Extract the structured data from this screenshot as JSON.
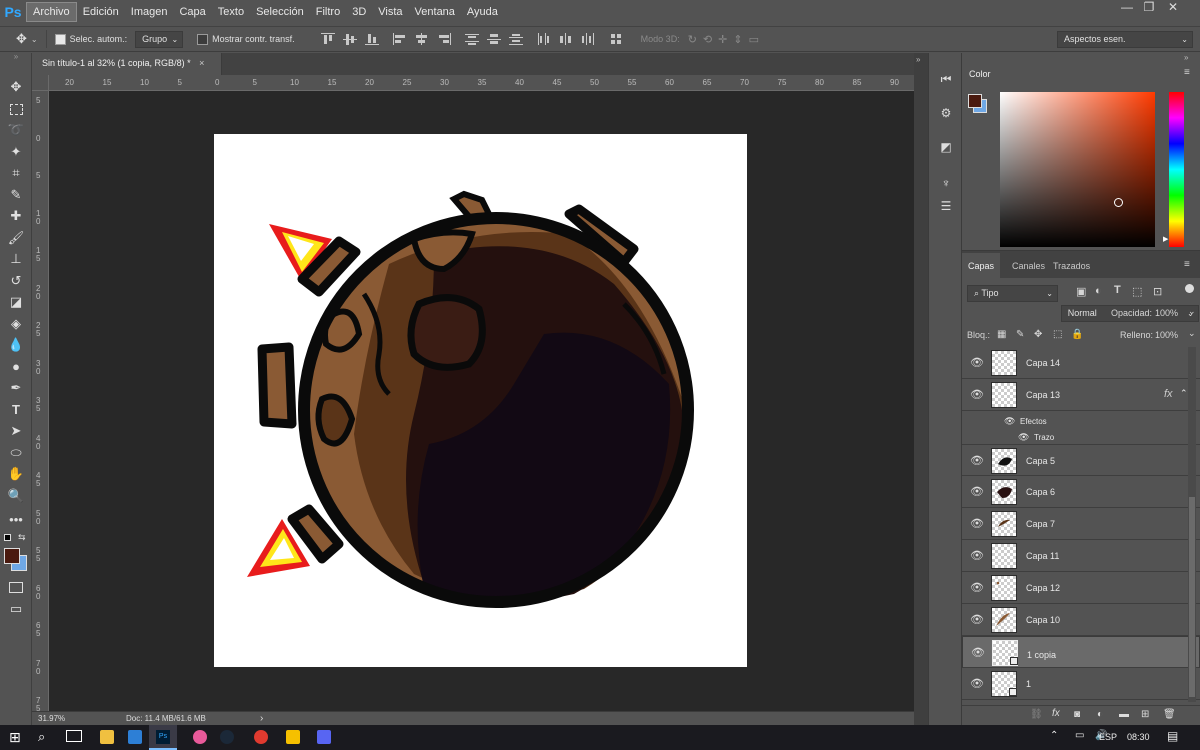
{
  "app": {
    "logo": "Ps"
  },
  "menu": [
    "Archivo",
    "Edición",
    "Imagen",
    "Capa",
    "Texto",
    "Selección",
    "Filtro",
    "3D",
    "Vista",
    "Ventana",
    "Ayuda"
  ],
  "window_controls": [
    "—",
    "❐",
    "✕"
  ],
  "options": {
    "auto_select_label": "Selec. autom.:",
    "auto_select_value": "Grupo",
    "transform_label": "Mostrar contr. transf.",
    "mode3d_label": "Modo 3D:",
    "workspace": "Aspectos esen."
  },
  "document": {
    "tab_title": "Sin título-1 al 32% (1 copia, RGB/8) *",
    "tab_close": "×"
  },
  "ruler": {
    "top": [
      "20",
      "15",
      "10",
      "5",
      "0",
      "5",
      "10",
      "15",
      "20",
      "25",
      "30",
      "35",
      "40",
      "45",
      "50",
      "55",
      "60",
      "65",
      "70",
      "75",
      "80",
      "85",
      "90"
    ],
    "left": [
      "5",
      "0",
      "5",
      "1 0",
      "1 5",
      "2 0",
      "2 5",
      "3 0",
      "3 5",
      "4 0",
      "4 5",
      "5 0",
      "5 5",
      "6 0",
      "6 5",
      "7 0",
      "7 5"
    ]
  },
  "status": {
    "zoom": "31.97%",
    "doc": "Doc: 11.4 MB/61.6 MB",
    "arrow": "›"
  },
  "color_panel": {
    "title": "Color",
    "fg": "#4a1a0f",
    "bg": "#6fa8e6"
  },
  "layers_panel": {
    "tabs": [
      "Capas",
      "Canales",
      "Trazados"
    ],
    "filter": "Tipo",
    "blend_mode": "Normal",
    "opacity_label": "Opacidad:",
    "opacity": "100%",
    "lock_label": "Bloq.:",
    "fill_label": "Relleno:",
    "fill": "100%",
    "layers": [
      {
        "name": "Capa 14"
      },
      {
        "name": "Capa 13",
        "fx": "fx"
      },
      {
        "name": "Capa 5"
      },
      {
        "name": "Capa 6"
      },
      {
        "name": "Capa 7"
      },
      {
        "name": "Capa 11"
      },
      {
        "name": "Capa 12"
      },
      {
        "name": "Capa 10"
      },
      {
        "name": "1 copia"
      },
      {
        "name": "1"
      }
    ],
    "effects_label": "Efectos",
    "stroke_label": "Trazo"
  },
  "taskbar": {
    "lang": "ESP",
    "time": "08:30"
  }
}
